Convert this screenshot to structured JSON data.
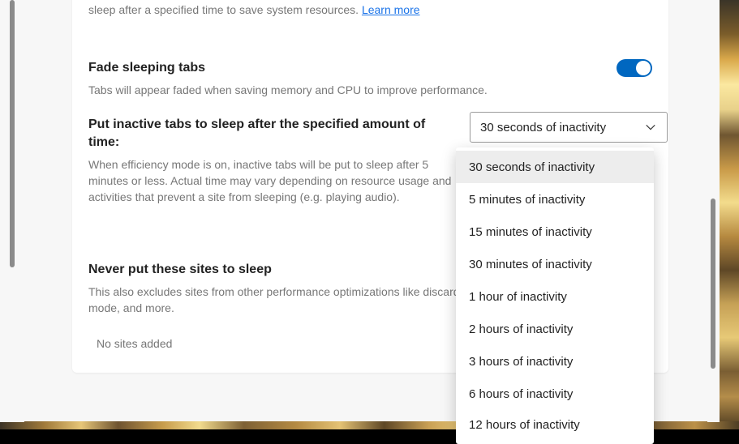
{
  "intro": {
    "text_fragment": "sleep after a specified time to save system resources. ",
    "learn_more": "Learn more"
  },
  "fade": {
    "title": "Fade sleeping tabs",
    "desc": "Tabs will appear faded when saving memory and CPU to improve performance.",
    "toggle_on": true
  },
  "sleep": {
    "title": "Put inactive tabs to sleep after the specified amount of time:",
    "desc": "When efficiency mode is on, inactive tabs will be put to sleep after 5 minutes or less. Actual time may vary depending on resource usage and activities that prevent a site from sleeping (e.g. playing audio).",
    "selected": "30 seconds of inactivity",
    "options": [
      "30 seconds of inactivity",
      "5 minutes of inactivity",
      "15 minutes of inactivity",
      "30 minutes of inactivity",
      "1 hour of inactivity",
      "2 hours of inactivity",
      "3 hours of inactivity",
      "6 hours of inactivity",
      "12 hours of inactivity"
    ]
  },
  "never": {
    "title": "Never put these sites to sleep",
    "desc": "This also excludes sites from other performance optimizations like discarding, efficiency mode, and more.",
    "empty": "No sites added"
  }
}
